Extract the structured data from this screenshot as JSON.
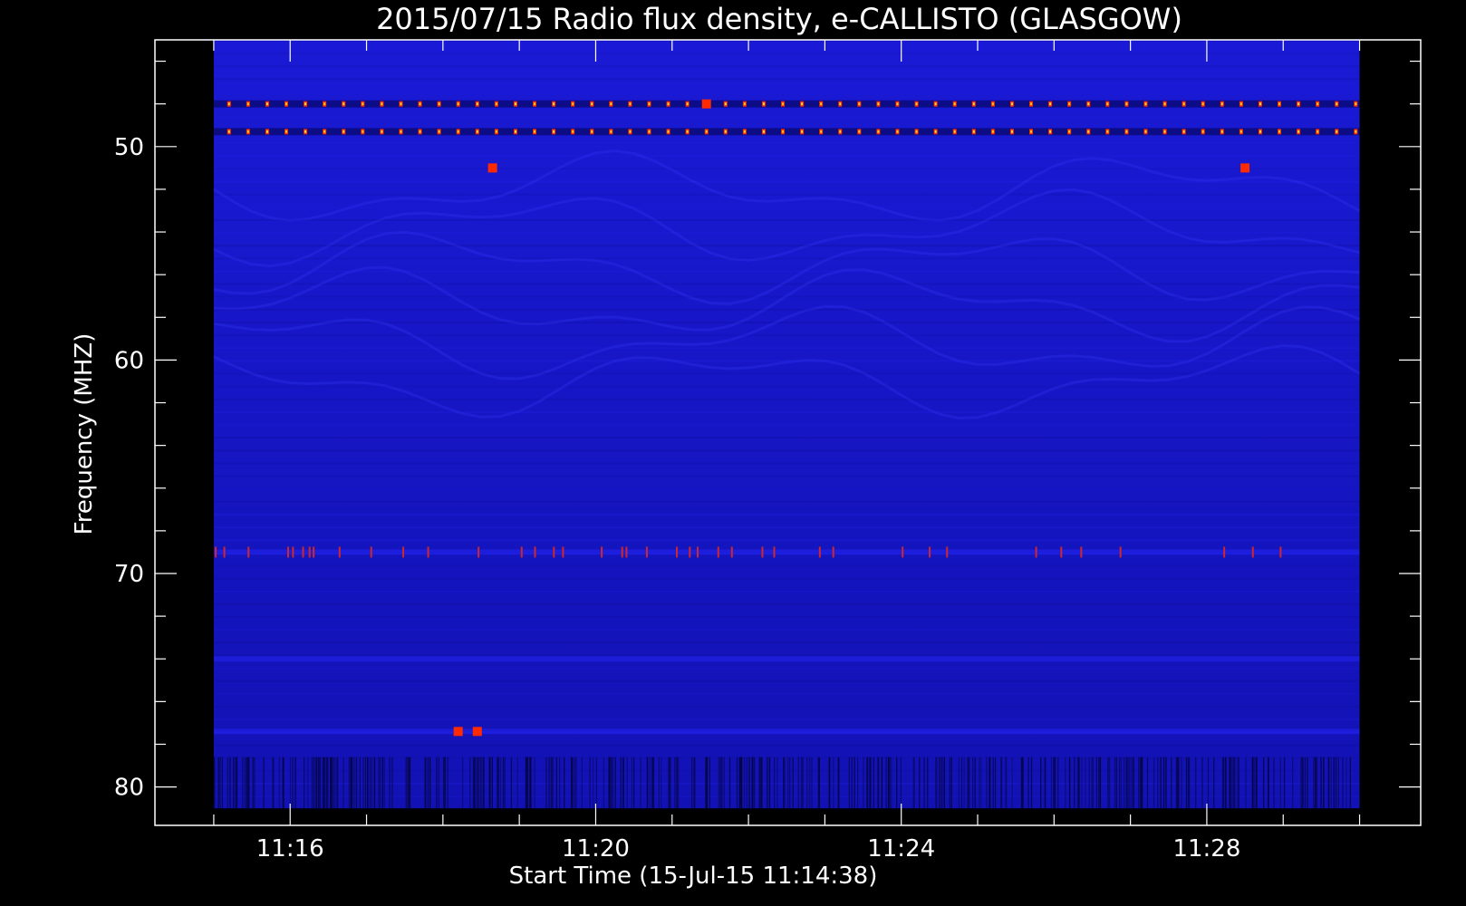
{
  "chart_data": {
    "type": "heatmap",
    "title": "2015/07/15  Radio flux density, e-CALLISTO (GLASGOW)",
    "xlabel": "Start Time (15-Jul-15 11:14:38)",
    "ylabel": "Frequency (MHZ)",
    "x_unit": "minutes",
    "x_ticks": [
      {
        "value": 16,
        "label": "11:16"
      },
      {
        "value": 20,
        "label": "11:20"
      },
      {
        "value": 24,
        "label": "11:24"
      },
      {
        "value": 28,
        "label": "11:28"
      }
    ],
    "x_minor_step": 1,
    "xlim": [
      14.23,
      30.8
    ],
    "data_x_range": [
      15.0,
      30.0
    ],
    "y_ticks": [
      50,
      60,
      70,
      80
    ],
    "y_minor_step": 2,
    "ylim": [
      45.0,
      81.8
    ],
    "data_y_range": [
      45.0,
      81.0
    ],
    "y_inverted": true,
    "grid": false,
    "colors": {
      "background": "#000000",
      "axes": "#ffffff",
      "spectrum_base": "#1414c8",
      "spectrum_dark": "#0a0a7a",
      "burst_hot": "#ff2a00",
      "burst_core": "#ffd030"
    },
    "interference_bands_mhz": [
      48.0,
      49.3,
      69.0,
      74.0,
      77.4
    ],
    "hot_spots": [
      {
        "time_min": 18.65,
        "freq_mhz": 51.0
      },
      {
        "time_min": 28.5,
        "freq_mhz": 51.0
      },
      {
        "time_min": 18.45,
        "freq_mhz": 77.4
      },
      {
        "time_min": 18.2,
        "freq_mhz": 77.4
      },
      {
        "time_min": 21.45,
        "freq_mhz": 48.0
      }
    ]
  }
}
